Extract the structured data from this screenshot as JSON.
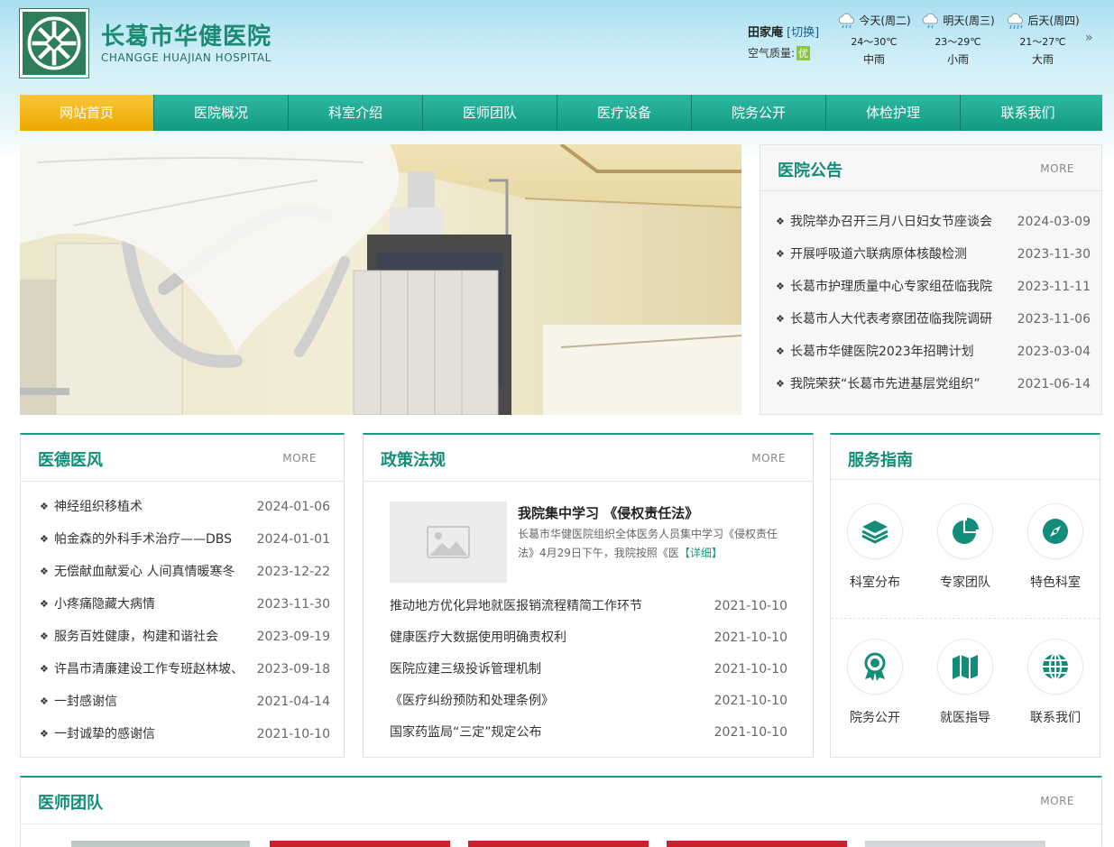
{
  "header": {
    "brand_cn": "长葛市华健医院",
    "brand_en": "CHANGGE HUAJIAN HOSPITAL",
    "location": "田家庵",
    "switch_label": "[切换]",
    "air_quality_label": "空气质量:",
    "air_quality_value": "优",
    "weather": [
      {
        "day": "今天(周二)",
        "temp": "24～30℃",
        "desc": "中雨"
      },
      {
        "day": "明天(周三)",
        "temp": "23～29℃",
        "desc": "小雨"
      },
      {
        "day": "后天(周四)",
        "temp": "21～27℃",
        "desc": "大雨"
      }
    ],
    "weather_next": "»"
  },
  "nav": {
    "items": [
      "网站首页",
      "医院概况",
      "科室介绍",
      "医师团队",
      "医疗设备",
      "院务公开",
      "体检护理",
      "联系我们"
    ],
    "active_index": 0
  },
  "notice": {
    "title": "医院公告",
    "more": "MORE",
    "items": [
      {
        "text": "我院举办召开三月八日妇女节座谈会",
        "date": "2024-03-09"
      },
      {
        "text": "开展呼吸道六联病原体核酸检测",
        "date": "2023-11-30"
      },
      {
        "text": "长葛市护理质量中心专家组莅临我院",
        "date": "2023-11-11"
      },
      {
        "text": "长葛市人大代表考察团莅临我院调研",
        "date": "2023-11-06"
      },
      {
        "text": "长葛市华健医院2023年招聘计划",
        "date": "2023-03-04"
      },
      {
        "text": "我院荣获“长葛市先进基层党组织”",
        "date": "2021-06-14"
      }
    ]
  },
  "yide": {
    "title": "医德医风",
    "more": "MORE",
    "items": [
      {
        "text": "神经组织移植术",
        "date": "2024-01-06"
      },
      {
        "text": "帕金森的外科手术治疗——DBS",
        "date": "2024-01-01"
      },
      {
        "text": "无偿献血献爱心 人间真情暖寒冬",
        "date": "2023-12-22"
      },
      {
        "text": "小疼痛隐藏大病情",
        "date": "2023-11-30"
      },
      {
        "text": "服务百姓健康，构建和谐社会",
        "date": "2023-09-19"
      },
      {
        "text": "许昌市清廉建设工作专班赵林坡、",
        "date": "2023-09-18"
      },
      {
        "text": "一封感谢信",
        "date": "2021-04-14"
      },
      {
        "text": "一封诚挚的感谢信",
        "date": "2021-10-10"
      }
    ]
  },
  "policy": {
    "title": "政策法规",
    "more": "MORE",
    "featured_title": "我院集中学习 《侵权责任法》",
    "featured_desc": "长葛市华健医院组织全体医务人员集中学习《侵权责任法》4月29日下午，我院按照《医",
    "featured_detail": "【详细】",
    "items": [
      {
        "text": "推动地方优化异地就医报销流程精简工作环节",
        "date": "2021-10-10"
      },
      {
        "text": "健康医疗大数据使用明确责权利",
        "date": "2021-10-10"
      },
      {
        "text": "医院应建三级投诉管理机制",
        "date": "2021-10-10"
      },
      {
        "text": "《医疗纠纷预防和处理条例》",
        "date": "2021-10-10"
      },
      {
        "text": "国家药监局“三定”规定公布",
        "date": "2021-10-10"
      }
    ]
  },
  "guide": {
    "title": "服务指南",
    "items": [
      {
        "label": "科室分布",
        "icon": "layers-icon"
      },
      {
        "label": "专家团队",
        "icon": "pie-chart-icon"
      },
      {
        "label": "特色科室",
        "icon": "compass-icon"
      },
      {
        "label": "院务公开",
        "icon": "award-icon"
      },
      {
        "label": "就医指导",
        "icon": "map-icon"
      },
      {
        "label": "联系我们",
        "icon": "globe-icon"
      }
    ],
    "icon_color": "#138d7a"
  },
  "team": {
    "title": "医师团队",
    "more": "MORE"
  },
  "colors": {
    "teal": "#1a9a84",
    "nav_active": "#f4b400",
    "title_teal": "#138d7a"
  }
}
